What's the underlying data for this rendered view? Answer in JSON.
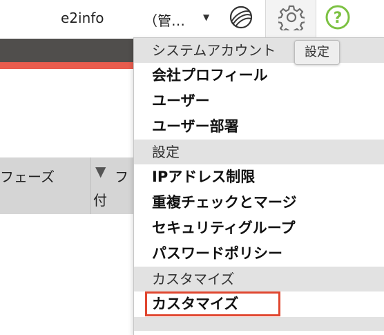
{
  "header": {
    "username": "e2info",
    "role": "（管…",
    "role_caret": "▼",
    "tooltip": "設定",
    "colors": {
      "accent_red": "#e85c4e",
      "dark_bar": "#504e4c",
      "help_green": "#7cc142",
      "highlight_border": "#e0462f"
    }
  },
  "table": {
    "col_phase": "フェーズ",
    "col_date_indicator": "▼",
    "col_date_line1": "フ",
    "col_date_line2": "付"
  },
  "menu": {
    "sections": [
      {
        "title": "システムアカウント",
        "items": [
          "会社プロフィール",
          "ユーザー",
          "ユーザー部署"
        ]
      },
      {
        "title": "設定",
        "items": [
          "IPアドレス制限",
          "重複チェックとマージ",
          "セキュリティグループ",
          "パスワードポリシー"
        ]
      },
      {
        "title": "カスタマイズ",
        "items": [
          "カスタマイズ"
        ]
      }
    ]
  }
}
